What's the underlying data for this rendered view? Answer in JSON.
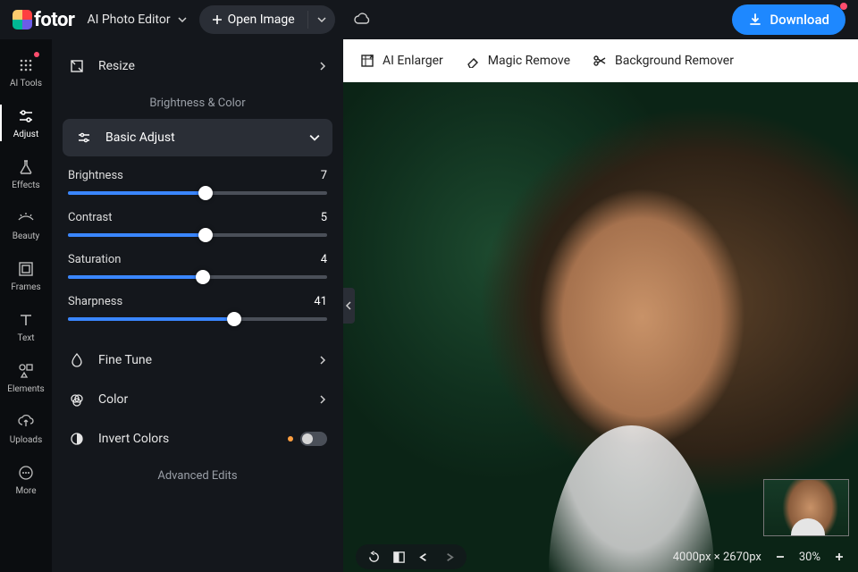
{
  "header": {
    "brand": "fotor",
    "editor_dropdown": "AI Photo Editor",
    "open_image": "Open Image",
    "download": "Download"
  },
  "rail": [
    {
      "id": "ai-tools",
      "label": "AI Tools"
    },
    {
      "id": "adjust",
      "label": "Adjust"
    },
    {
      "id": "effects",
      "label": "Effects"
    },
    {
      "id": "beauty",
      "label": "Beauty"
    },
    {
      "id": "frames",
      "label": "Frames"
    },
    {
      "id": "text",
      "label": "Text"
    },
    {
      "id": "elements",
      "label": "Elements"
    },
    {
      "id": "uploads",
      "label": "Uploads"
    },
    {
      "id": "more",
      "label": "More"
    }
  ],
  "panel": {
    "resize": "Resize",
    "section1": "Brightness & Color",
    "basic_adjust": "Basic Adjust",
    "sliders": {
      "brightness": {
        "label": "Brightness",
        "value": 7,
        "pct": 53
      },
      "contrast": {
        "label": "Contrast",
        "value": 5,
        "pct": 53
      },
      "saturation": {
        "label": "Saturation",
        "value": 4,
        "pct": 52
      },
      "sharpness": {
        "label": "Sharpness",
        "value": 41,
        "pct": 64
      }
    },
    "fine_tune": "Fine Tune",
    "color": "Color",
    "invert": "Invert Colors",
    "section2": "Advanced Edits"
  },
  "toolbar": {
    "ai_enlarger": "AI Enlarger",
    "magic_remove": "Magic Remove",
    "bg_remover": "Background Remover"
  },
  "bottombar": {
    "dimensions": "4000px × 2670px",
    "zoom": "30%"
  }
}
